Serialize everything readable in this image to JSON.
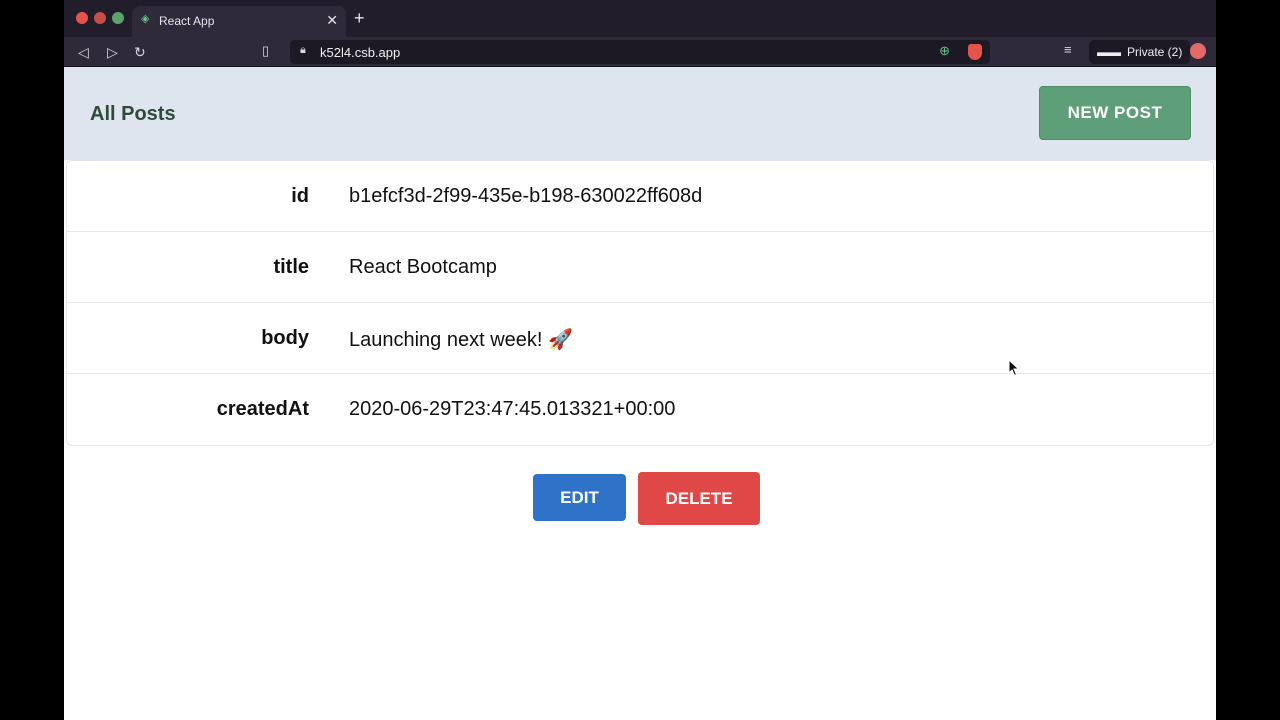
{
  "browser": {
    "tab_title": "React App",
    "url": "k52l4.csb.app",
    "private_label": "Private (2)",
    "new_tab_glyph": "+",
    "close_glyph": "✕"
  },
  "app": {
    "page_title": "All Posts",
    "new_post_label": "NEW POST",
    "post": {
      "rows": [
        {
          "label": "id",
          "value": "b1efcf3d-2f99-435e-b198-630022ff608d"
        },
        {
          "label": "title",
          "value": "React Bootcamp"
        },
        {
          "label": "body",
          "value": "Launching next week! 🚀"
        },
        {
          "label": "createdAt",
          "value": "2020-06-29T23:47:45.013321+00:00"
        }
      ]
    },
    "edit_label": "EDIT",
    "delete_label": "DELETE"
  },
  "colors": {
    "header_bg": "#dfe5ee",
    "new_post_bg": "#5e9e78",
    "edit_bg": "#2f73c9",
    "delete_bg": "#e04848"
  },
  "icons": [
    "sandbox-icon",
    "close-icon",
    "plus-icon",
    "back-icon",
    "forward-icon",
    "reload-icon",
    "bookmark-icon",
    "lock-icon",
    "zoom-icon",
    "brave-shield-icon",
    "reader-icon",
    "private-glasses-icon",
    "profile-icon",
    "cursor-icon"
  ]
}
